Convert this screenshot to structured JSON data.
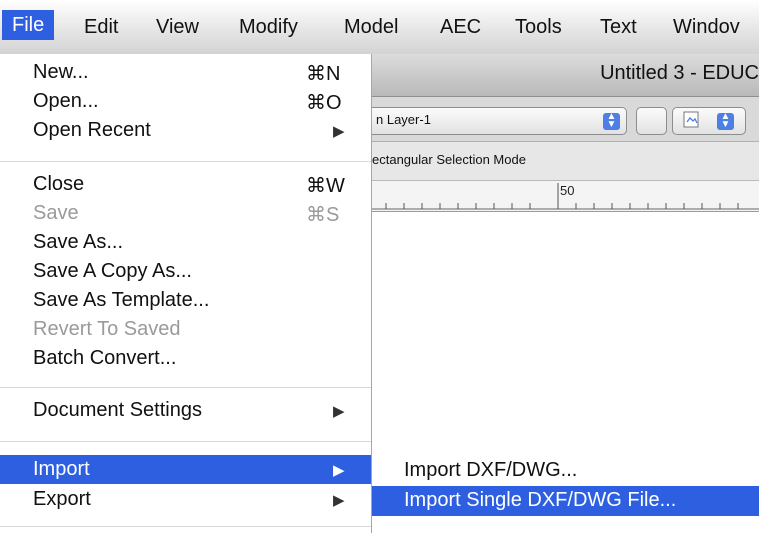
{
  "menubar": {
    "items": [
      "File",
      "Edit",
      "View",
      "Modify",
      "Model",
      "AEC",
      "Tools",
      "Text",
      "Windov"
    ]
  },
  "window": {
    "title": "Untitled 3 - EDUC",
    "layer": "n Layer-1",
    "mode_text": "ectangular Selection Mode",
    "ruler_label": "50"
  },
  "file_menu": {
    "items": [
      {
        "label": "New...",
        "shortcut": "⌘N"
      },
      {
        "label": "Open...",
        "shortcut": "⌘O"
      },
      {
        "label": "Open Recent",
        "submenu": true
      },
      {
        "label": "Close",
        "shortcut": "⌘W"
      },
      {
        "label": "Save",
        "shortcut": "⌘S",
        "disabled": true
      },
      {
        "label": "Save As..."
      },
      {
        "label": "Save A Copy As..."
      },
      {
        "label": "Save As Template..."
      },
      {
        "label": "Revert To Saved",
        "disabled": true
      },
      {
        "label": "Batch Convert..."
      },
      {
        "label": "Document Settings",
        "submenu": true
      },
      {
        "label": "Import",
        "submenu": true,
        "highlighted": true
      },
      {
        "label": "Export",
        "submenu": true
      }
    ]
  },
  "import_submenu": {
    "items": [
      {
        "label": "Import DXF/DWG..."
      },
      {
        "label": "Import Single DXF/DWG File...",
        "highlighted": true
      }
    ]
  },
  "icons": {
    "submenu_arrow": "▶",
    "stepper_up": "▲",
    "stepper_down": "▼"
  },
  "colors": {
    "highlight": "#2d5fe0"
  }
}
